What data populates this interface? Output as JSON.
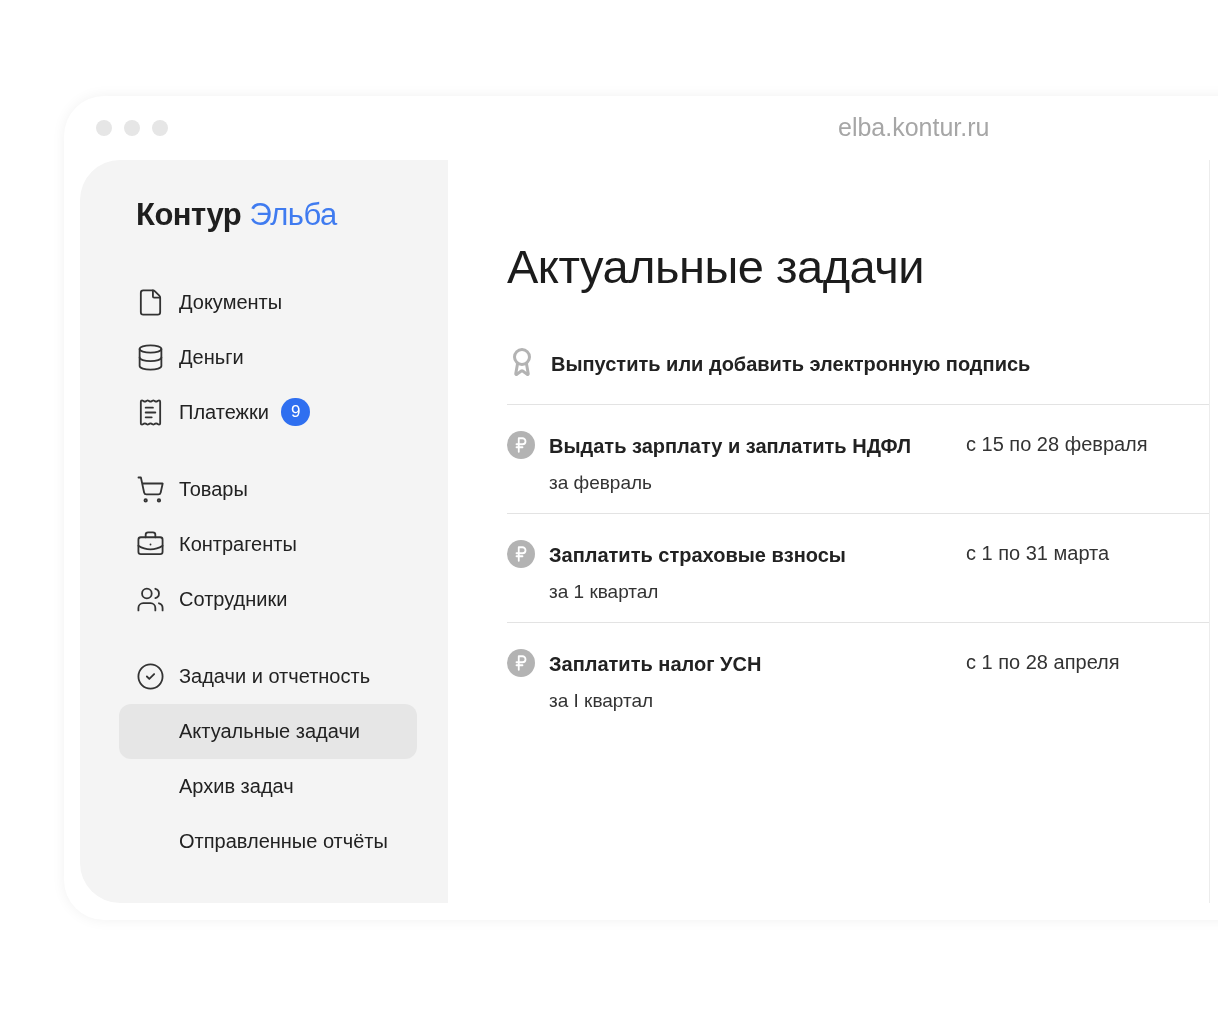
{
  "browser": {
    "address": "elba.kontur.ru"
  },
  "logo": {
    "brand": "Контур",
    "product": "Эльба"
  },
  "sidebar": {
    "groups": [
      {
        "items": [
          {
            "label": "Документы",
            "kind": "document",
            "selected": false
          },
          {
            "label": "Деньги",
            "kind": "money",
            "selected": false
          },
          {
            "label": "Платежки",
            "kind": "payments",
            "badge": "9",
            "selected": false
          }
        ]
      },
      {
        "items": [
          {
            "label": "Товары",
            "kind": "goods",
            "selected": false
          },
          {
            "label": "Контрагенты",
            "kind": "contractors",
            "selected": false
          },
          {
            "label": "Сотрудники",
            "kind": "employees",
            "selected": false
          }
        ]
      },
      {
        "items": [
          {
            "label": "Задачи и отчетность",
            "kind": "tasks",
            "selected": false
          },
          {
            "label": "Актуальные задачи",
            "kind": "sub",
            "selected": true
          },
          {
            "label": "Архив задач",
            "kind": "sub",
            "selected": false
          },
          {
            "label": "Отправленные отчёты",
            "kind": "sub",
            "selected": false
          }
        ]
      }
    ]
  },
  "main": {
    "title": "Актуальные задачи",
    "tasks": [
      {
        "kind": "signature",
        "title": "Выпустить или добавить электронную подпись"
      },
      {
        "kind": "payment",
        "title": "Выдать зарплату и заплатить НДФЛ",
        "subtitle": "за февраль",
        "period": "с 15 по 28 февраля"
      },
      {
        "kind": "payment",
        "title": "Заплатить страховые взносы",
        "subtitle": "за 1 квартал",
        "period": "с 1 по 31 марта"
      },
      {
        "kind": "payment",
        "title": "Заплатить налог УСН",
        "subtitle": "за I квартал",
        "period": "с 1 по 28 апреля"
      }
    ]
  }
}
